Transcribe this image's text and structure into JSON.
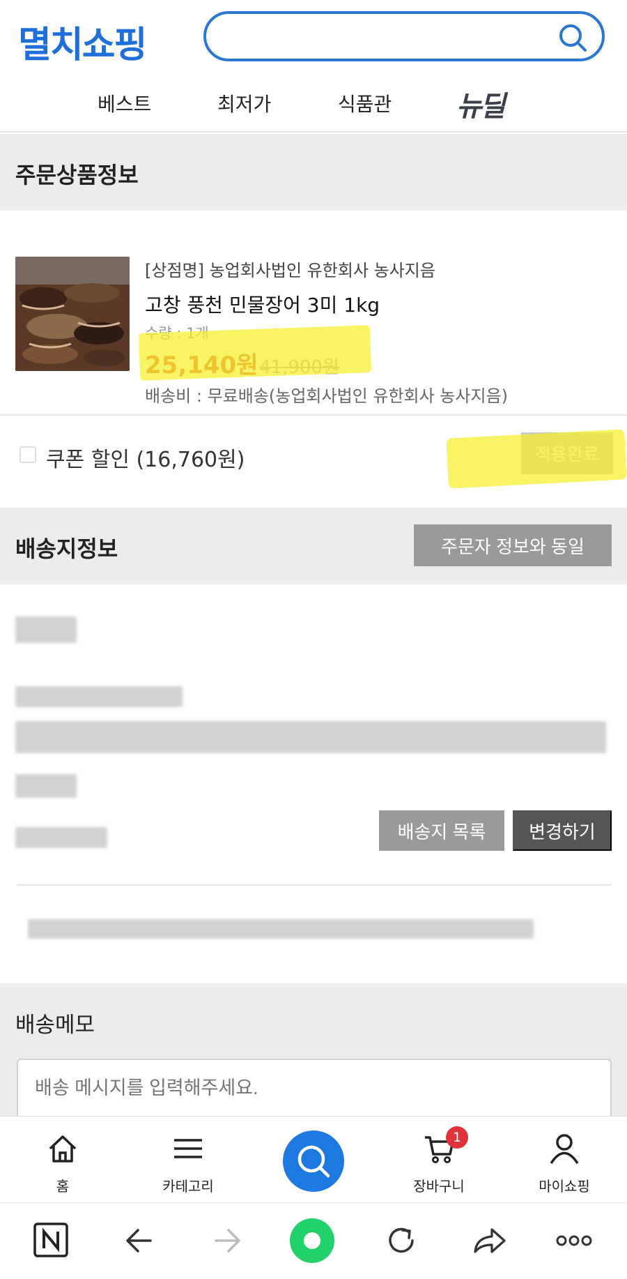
{
  "header": {
    "logo": "멸치쇼핑",
    "search_placeholder": "",
    "nav": [
      "베스트",
      "최저가",
      "식품관"
    ],
    "newdeal": "뉴딜"
  },
  "order_section": {
    "title": "주문상품정보"
  },
  "product": {
    "store": "[상점명] 농업회사법인 유한회사 농사지음",
    "name": "고창 풍천 민물장어 3미 1kg",
    "quantity": "수량 : 1개",
    "price": "25,140원",
    "original_price": "41,900원",
    "shipping": "배송비 : 무료배송(농업회사법인 유한회사 농사지음)"
  },
  "coupon": {
    "label": "쿠폰 할인 (16,760원)",
    "apply_button": "적용완료"
  },
  "shipping_section": {
    "title": "배송지정보",
    "same_as_orderer_button": "주문자 정보와 동일",
    "address_list_button": "배송지 목록",
    "change_button": "변경하기"
  },
  "memo": {
    "title": "배송메모",
    "placeholder": "배송 메시지를 입력해주세요."
  },
  "tabbar": {
    "home": "홈",
    "category": "카테고리",
    "cart": "장바구니",
    "cart_count": "1",
    "myshopping": "마이쇼핑"
  },
  "colors": {
    "brand_blue": "#1e6fd9",
    "price_red": "#d4553f",
    "highlight_yellow": "#f6f028",
    "badge_red": "#e0333a",
    "browser_green": "#22d16a"
  }
}
